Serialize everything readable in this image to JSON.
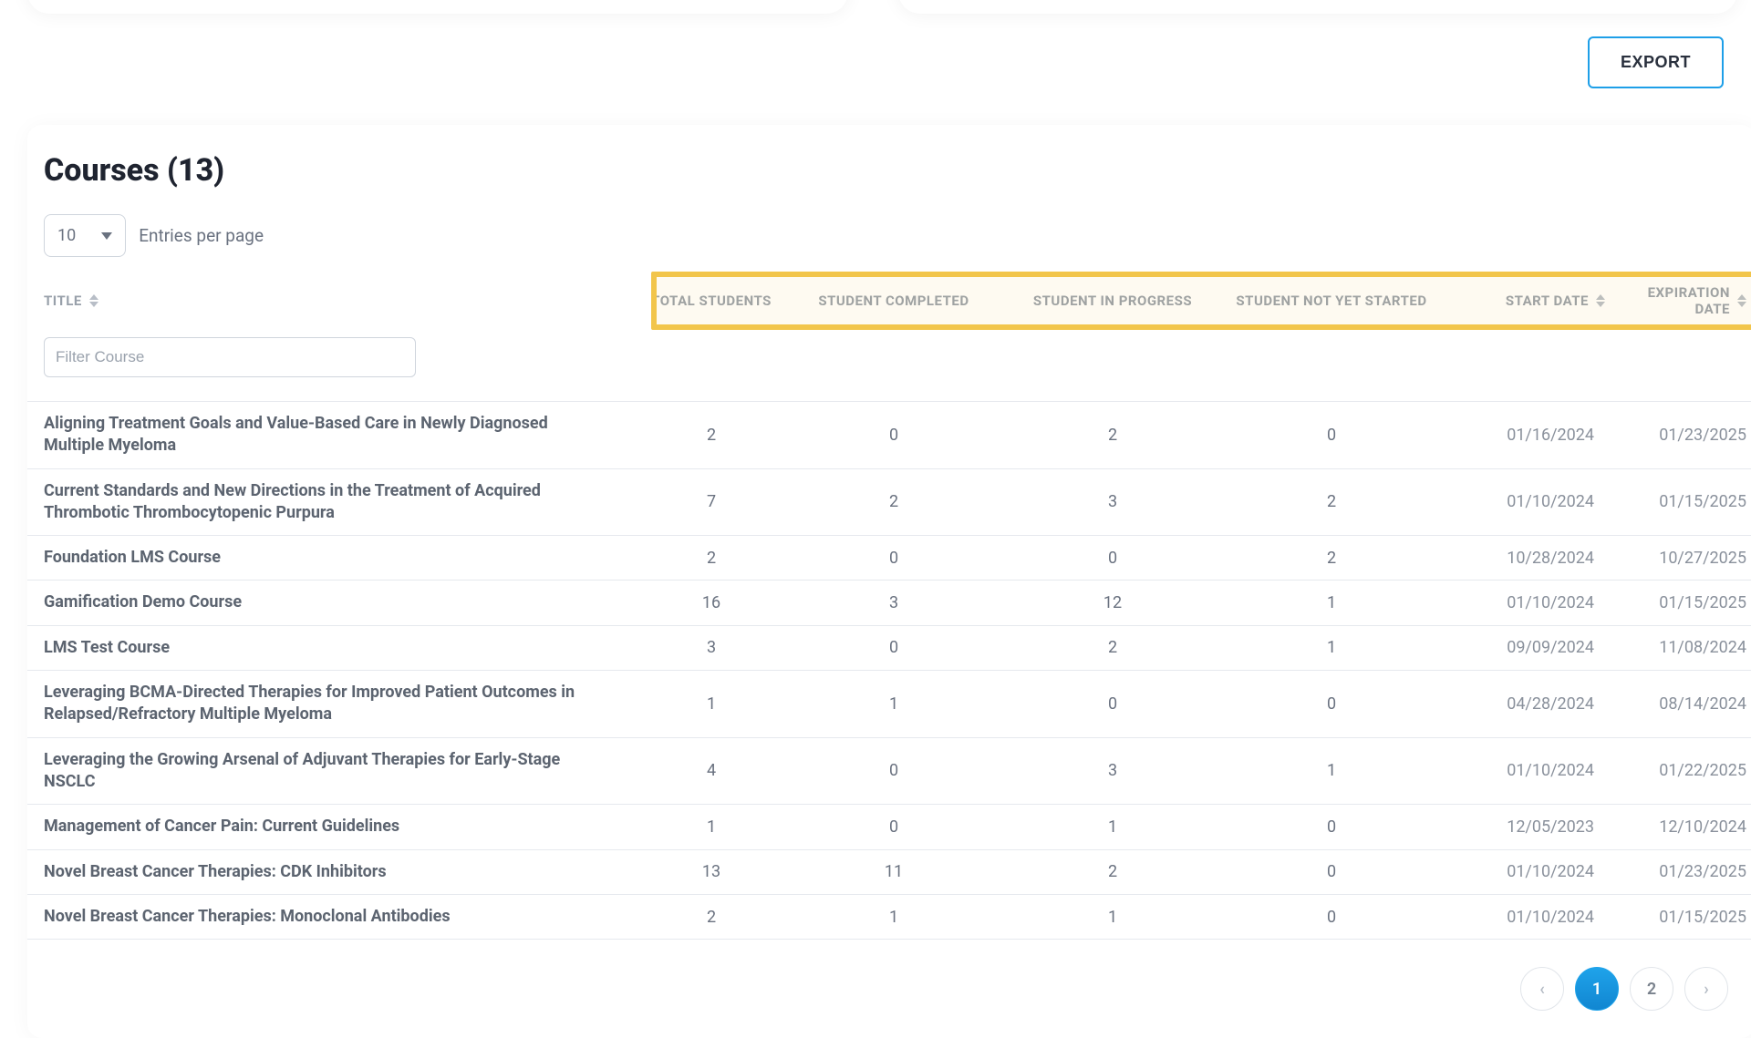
{
  "export_label": "EXPORT",
  "card_title": "Courses (13)",
  "entries": {
    "value": "10",
    "label": "Entries per page"
  },
  "filter_placeholder": "Filter Course",
  "columns": {
    "title": "TITLE",
    "total": "TOTAL STUDENTS",
    "completed": "STUDENT COMPLETED",
    "in_progress": "STUDENT IN PROGRESS",
    "not_started": "STUDENT NOT YET STARTED",
    "start": "START DATE",
    "expiration": "EXPIRATION DATE"
  },
  "rows": [
    {
      "title": "Aligning Treatment Goals and Value-Based Care in Newly Diagnosed Multiple Myeloma",
      "total": "2",
      "completed": "0",
      "in_progress": "2",
      "not_started": "0",
      "start": "01/16/2024",
      "expiration": "01/23/2025"
    },
    {
      "title": "Current Standards and New Directions in the Treatment of Acquired Thrombotic Thrombocytopenic Purpura",
      "total": "7",
      "completed": "2",
      "in_progress": "3",
      "not_started": "2",
      "start": "01/10/2024",
      "expiration": "01/15/2025"
    },
    {
      "title": "Foundation LMS Course",
      "total": "2",
      "completed": "0",
      "in_progress": "0",
      "not_started": "2",
      "start": "10/28/2024",
      "expiration": "10/27/2025"
    },
    {
      "title": "Gamification Demo Course",
      "total": "16",
      "completed": "3",
      "in_progress": "12",
      "not_started": "1",
      "start": "01/10/2024",
      "expiration": "01/15/2025"
    },
    {
      "title": "LMS Test Course",
      "total": "3",
      "completed": "0",
      "in_progress": "2",
      "not_started": "1",
      "start": "09/09/2024",
      "expiration": "11/08/2024"
    },
    {
      "title": "Leveraging BCMA-Directed Therapies for Improved Patient Outcomes in Relapsed/Refractory Multiple Myeloma",
      "total": "1",
      "completed": "1",
      "in_progress": "0",
      "not_started": "0",
      "start": "04/28/2024",
      "expiration": "08/14/2024"
    },
    {
      "title": "Leveraging the Growing Arsenal of Adjuvant Therapies for Early-Stage NSCLC",
      "total": "4",
      "completed": "0",
      "in_progress": "3",
      "not_started": "1",
      "start": "01/10/2024",
      "expiration": "01/22/2025"
    },
    {
      "title": "Management of Cancer Pain: Current Guidelines",
      "total": "1",
      "completed": "0",
      "in_progress": "1",
      "not_started": "0",
      "start": "12/05/2023",
      "expiration": "12/10/2024"
    },
    {
      "title": "Novel Breast Cancer Therapies: CDK Inhibitors",
      "total": "13",
      "completed": "11",
      "in_progress": "2",
      "not_started": "0",
      "start": "01/10/2024",
      "expiration": "01/23/2025"
    },
    {
      "title": "Novel Breast Cancer Therapies: Monoclonal Antibodies",
      "total": "2",
      "completed": "1",
      "in_progress": "1",
      "not_started": "0",
      "start": "01/10/2024",
      "expiration": "01/15/2025"
    }
  ],
  "pagination": {
    "prev": "‹",
    "pages": [
      "1",
      "2"
    ],
    "active_index": 0,
    "next": "›"
  }
}
